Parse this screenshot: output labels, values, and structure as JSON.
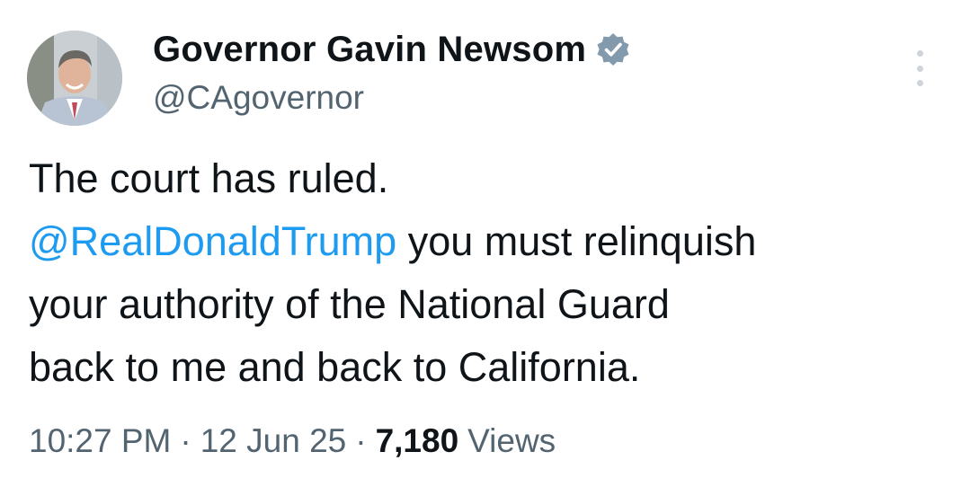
{
  "author": {
    "display_name": "Governor Gavin Newsom",
    "handle": "@CAgovernor",
    "verified_badge_icon": "verified-badge-icon",
    "badge_color": "#829aab"
  },
  "tweet": {
    "line1": "The court has ruled.",
    "mention": "@RealDonaldTrump",
    "line2_rest": " you must relinquish",
    "line3": "your authority of the National Guard",
    "line4": "back to me and back to California.",
    "mention_color": "#1d9bf0"
  },
  "meta": {
    "time": "10:27 PM",
    "separator": "·",
    "date": "12 Jun 25",
    "views_count": "7,180",
    "views_label": "Views"
  },
  "icons": {
    "more": "more-options-icon",
    "avatar": "avatar"
  }
}
